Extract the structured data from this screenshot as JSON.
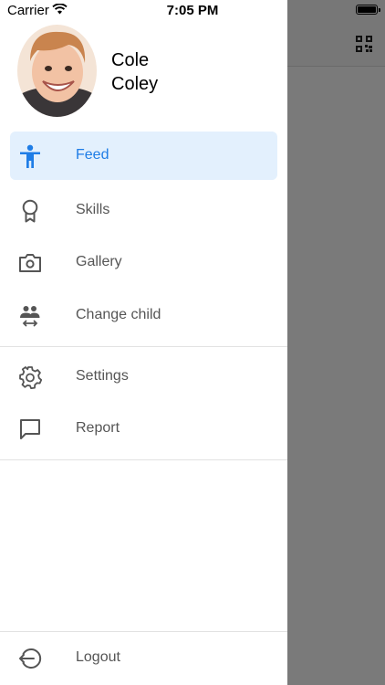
{
  "status_bar": {
    "carrier": "Carrier",
    "time": "7:05 PM"
  },
  "profile": {
    "first_name": "Cole",
    "last_name": "Coley"
  },
  "menu": {
    "feed": "Feed",
    "skills": "Skills",
    "gallery": "Gallery",
    "change_child": "Change child",
    "settings": "Settings",
    "report": "Report",
    "logout": "Logout"
  },
  "colors": {
    "accent": "#1f7de6",
    "active_bg": "#e3f0fd",
    "overlay": "#7a7a7a"
  },
  "icons": [
    "wifi-icon",
    "battery-icon",
    "qr-code-icon",
    "person-icon",
    "badge-icon",
    "camera-icon",
    "people-swap-icon",
    "gear-icon",
    "chat-bubble-icon",
    "logout-icon"
  ]
}
